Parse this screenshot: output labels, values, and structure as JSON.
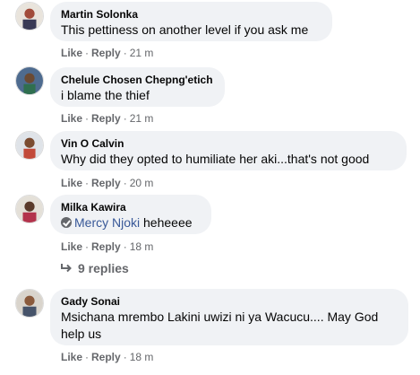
{
  "comments": [
    {
      "author": "Martin Solonka",
      "text": "This pettiness on another level if you ask me",
      "like": "Like",
      "reply": "Reply",
      "time": "21 m"
    },
    {
      "author": "Chelule Chosen Chepng'etich",
      "text": "i blame the thief",
      "like": "Like",
      "reply": "Reply",
      "time": "21 m"
    },
    {
      "author": "Vin O Calvin",
      "text": "Why did they opted to humiliate her aki...that's not good",
      "like": "Like",
      "reply": "Reply",
      "time": "20 m"
    },
    {
      "author": "Milka Kawira",
      "mention": "Mercy Njoki",
      "text": " heheeee",
      "like": "Like",
      "reply": "Reply",
      "time": "18 m"
    },
    {
      "author": "Gady Sonai",
      "text_line1": "Msichana mrembo Lakini uwizi ni ya Wacucu.... May God",
      "text_line2": "help us",
      "like": "Like",
      "reply": "Reply",
      "time": "18 m"
    }
  ],
  "replies_link": "9 replies",
  "separator": "·",
  "colors": {
    "bubble": "#f0f2f5",
    "meta": "#65676b",
    "mention": "#385898"
  },
  "icons": [
    "avatar",
    "mention-check-icon",
    "reply-arrow-icon"
  ]
}
